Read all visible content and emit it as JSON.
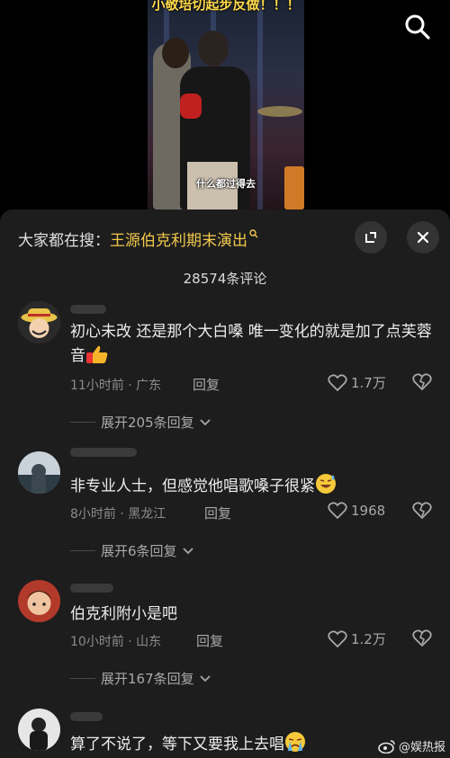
{
  "video": {
    "top_text": "小敬培切起步反做！！！",
    "caption": "什么都过得去",
    "search_icon": "search-icon"
  },
  "panel": {
    "search_prefix": "大家都在搜：",
    "search_term": "王源伯克利期末演出",
    "comment_count": "28574条评论",
    "icons": {
      "expand": "collapse-window-icon",
      "close": "close-icon"
    }
  },
  "comments": [
    {
      "text": "初心未改 还是那个大白嗓 唯一变化的就是加了点芙蓉音",
      "emoji": "thumbs-up-emoji",
      "meta": "11小时前 · 广东",
      "reply_label": "回复",
      "likes": "1.7万",
      "expand_label": "展开205条回复"
    },
    {
      "text": "非专业人士，但感觉他唱歌嗓子很紧",
      "emoji": "grinning-sweat-emoji",
      "meta": "8小时前 · 黑龙江",
      "reply_label": "回复",
      "likes": "1968",
      "expand_label": "展开6条回复"
    },
    {
      "text": "伯克利附小是吧",
      "meta": "10小时前 · 山东",
      "reply_label": "回复",
      "likes": "1.2万",
      "expand_label": "展开167条回复"
    },
    {
      "text": "算了不说了，等下又要我上去唱",
      "emoji": "crying-emoji"
    }
  ],
  "watermark": "@娱热报",
  "colors": {
    "highlight": "#f2c94c",
    "panel_bg": "#1d1d1d",
    "meta": "#8c8c8c"
  }
}
